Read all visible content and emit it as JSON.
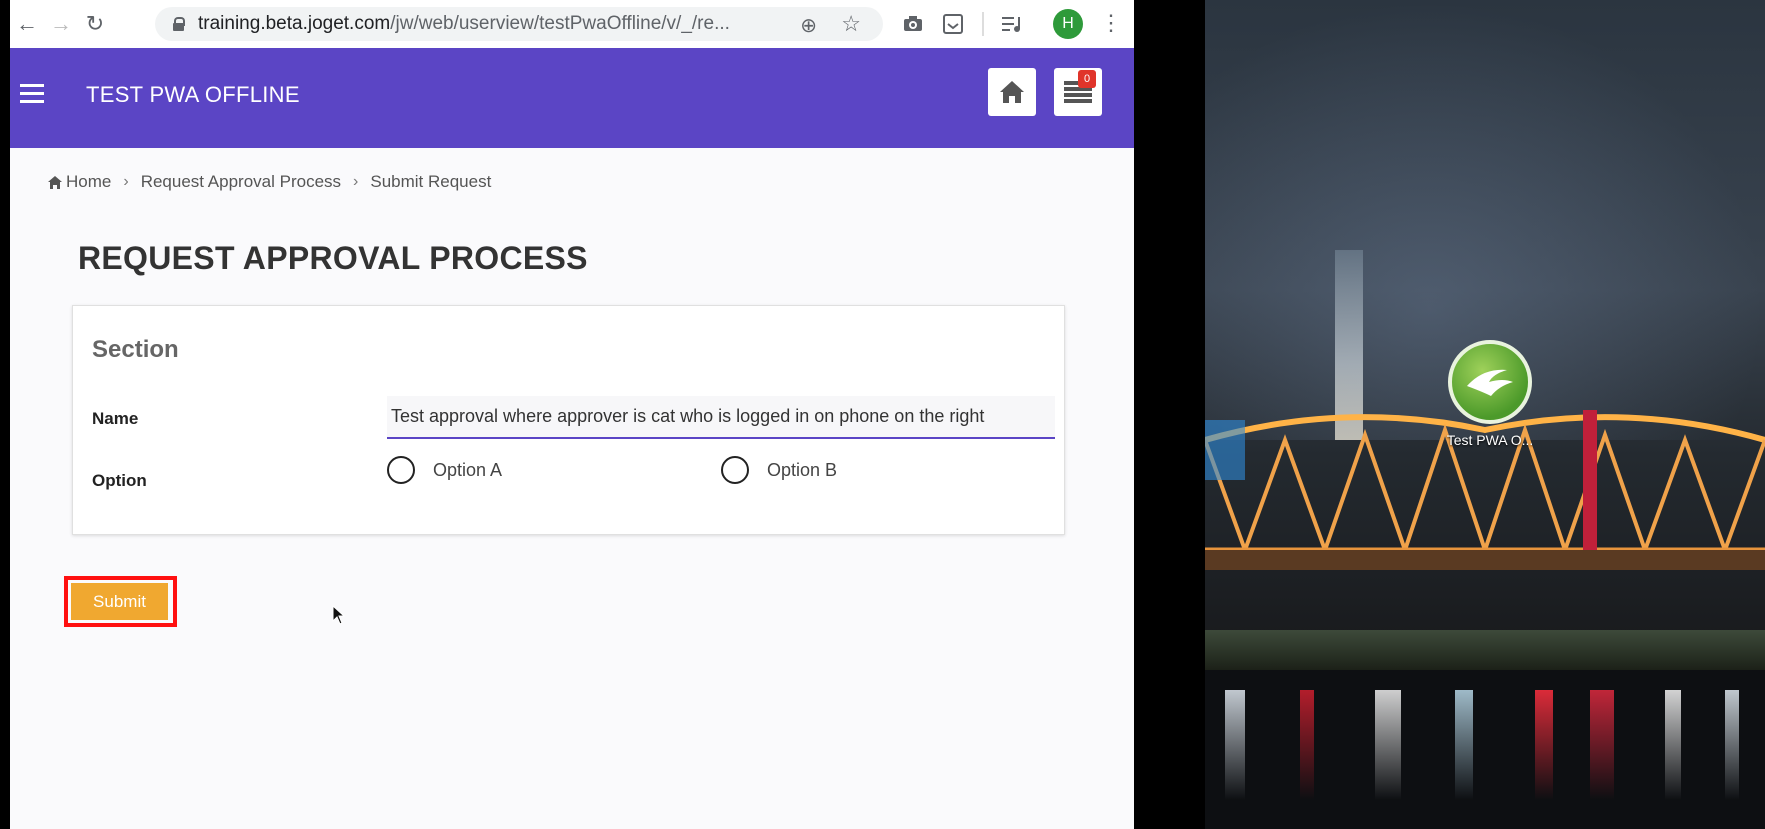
{
  "browser": {
    "url_host": "training.beta.joget.com",
    "url_path": "/jw/web/userview/testPwaOffline/v/_/re...",
    "avatar_letter": "H"
  },
  "app": {
    "title": "TEST PWA OFFLINE",
    "inbox_count": "0"
  },
  "breadcrumb": {
    "home": "Home",
    "sep": "›",
    "items": [
      "Request Approval Process",
      "Submit Request"
    ]
  },
  "page_title": "REQUEST APPROVAL PROCESS",
  "form": {
    "section_title": "Section",
    "name_label": "Name",
    "name_value": "Test approval where approver is cat who is logged in on phone on the right",
    "option_label": "Option",
    "options": [
      "Option A",
      "Option B"
    ],
    "submit_label": "Submit"
  },
  "phone": {
    "app_icon_label": "Test PWA O..."
  },
  "colors": {
    "header": "#5b45c5",
    "submit": "#f0a830",
    "highlight": "#ff1010",
    "badge": "#e0342a",
    "avatar": "#2e9a3a"
  }
}
